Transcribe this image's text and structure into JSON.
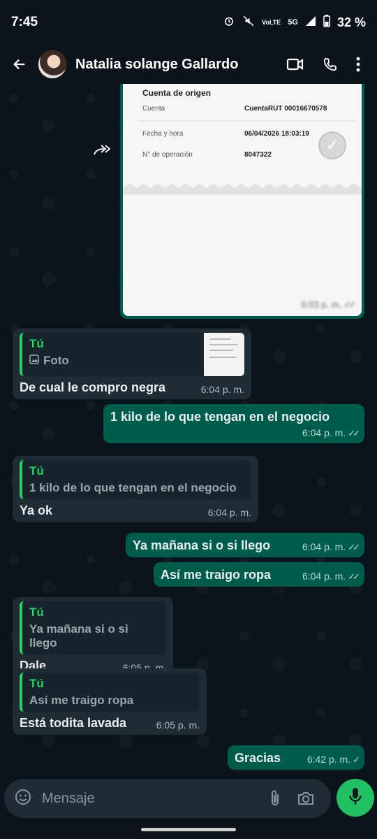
{
  "status": {
    "time": "7:45",
    "network": "5G",
    "volte": "VoLTE",
    "battery": "32 %"
  },
  "header": {
    "contact_name": "Natalia solange Gallardo"
  },
  "receipt": {
    "section_title": "Cuenta de origen",
    "rows": [
      {
        "label": "Cuenta",
        "value": "CuentaRUT 00016670578"
      },
      {
        "label": "Fecha y hora",
        "value": "06/04/2026 18:03:19"
      },
      {
        "label": "N° de operación",
        "value": "8047322"
      }
    ],
    "time": "6:03 p. m."
  },
  "messages": [
    {
      "dir": "in",
      "quote_author": "Tú",
      "quote_text": "Foto",
      "text": "De cual le compro negra",
      "time": "6:04 p. m."
    },
    {
      "dir": "out",
      "text": "1 kilo de lo que tengan en el negocio",
      "time": "6:04 p. m."
    },
    {
      "dir": "in",
      "quote_author": "Tú",
      "quote_text": "1 kilo de lo que tengan en el negocio",
      "text": "Ya ok",
      "time": "6:04 p. m."
    },
    {
      "dir": "out",
      "text": "Ya mañana si o si llego",
      "time": "6:04 p. m."
    },
    {
      "dir": "out",
      "text": "Así me traigo ropa",
      "time": "6:04 p. m."
    },
    {
      "dir": "in",
      "quote_author": "Tú",
      "quote_text": "Ya mañana si o si llego",
      "text": "Dale",
      "time": "6:05 p. m."
    },
    {
      "dir": "in",
      "quote_author": "Tú",
      "quote_text": "Así me traigo ropa",
      "text": "Está todita lavada",
      "time": "6:05 p. m."
    },
    {
      "dir": "out",
      "text": "Gracias",
      "time": "6:42 p. m."
    }
  ],
  "input": {
    "placeholder": "Mensaje"
  },
  "colors": {
    "accent": "#25d366",
    "outgoing": "#005c4b",
    "incoming": "#1f2c34",
    "background": "#0b141a"
  }
}
